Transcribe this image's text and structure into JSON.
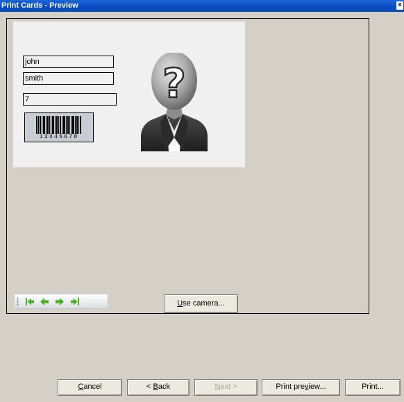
{
  "window": {
    "title": "Print Cards - Preview",
    "close_glyph": "×"
  },
  "card": {
    "first_name": "john",
    "last_name": "smith",
    "number": "7",
    "barcode_digits": "12345678",
    "photo_icon": "unknown-person-icon"
  },
  "nav": {
    "icons": [
      "first-record-icon",
      "previous-record-icon",
      "next-record-icon",
      "last-record-icon"
    ],
    "color": "#4caf2a"
  },
  "buttons": {
    "use_camera": {
      "mn": "U",
      "rest": "se camera..."
    },
    "cancel": {
      "mn": "C",
      "rest": "ancel"
    },
    "back": {
      "pre": "< ",
      "mn": "B",
      "rest": "ack"
    },
    "next": {
      "mn": "N",
      "rest": "ext >"
    },
    "print_preview": {
      "pre": "Print pre",
      "mn": "v",
      "rest": "iew..."
    },
    "print": {
      "pre": "Print..."
    }
  }
}
